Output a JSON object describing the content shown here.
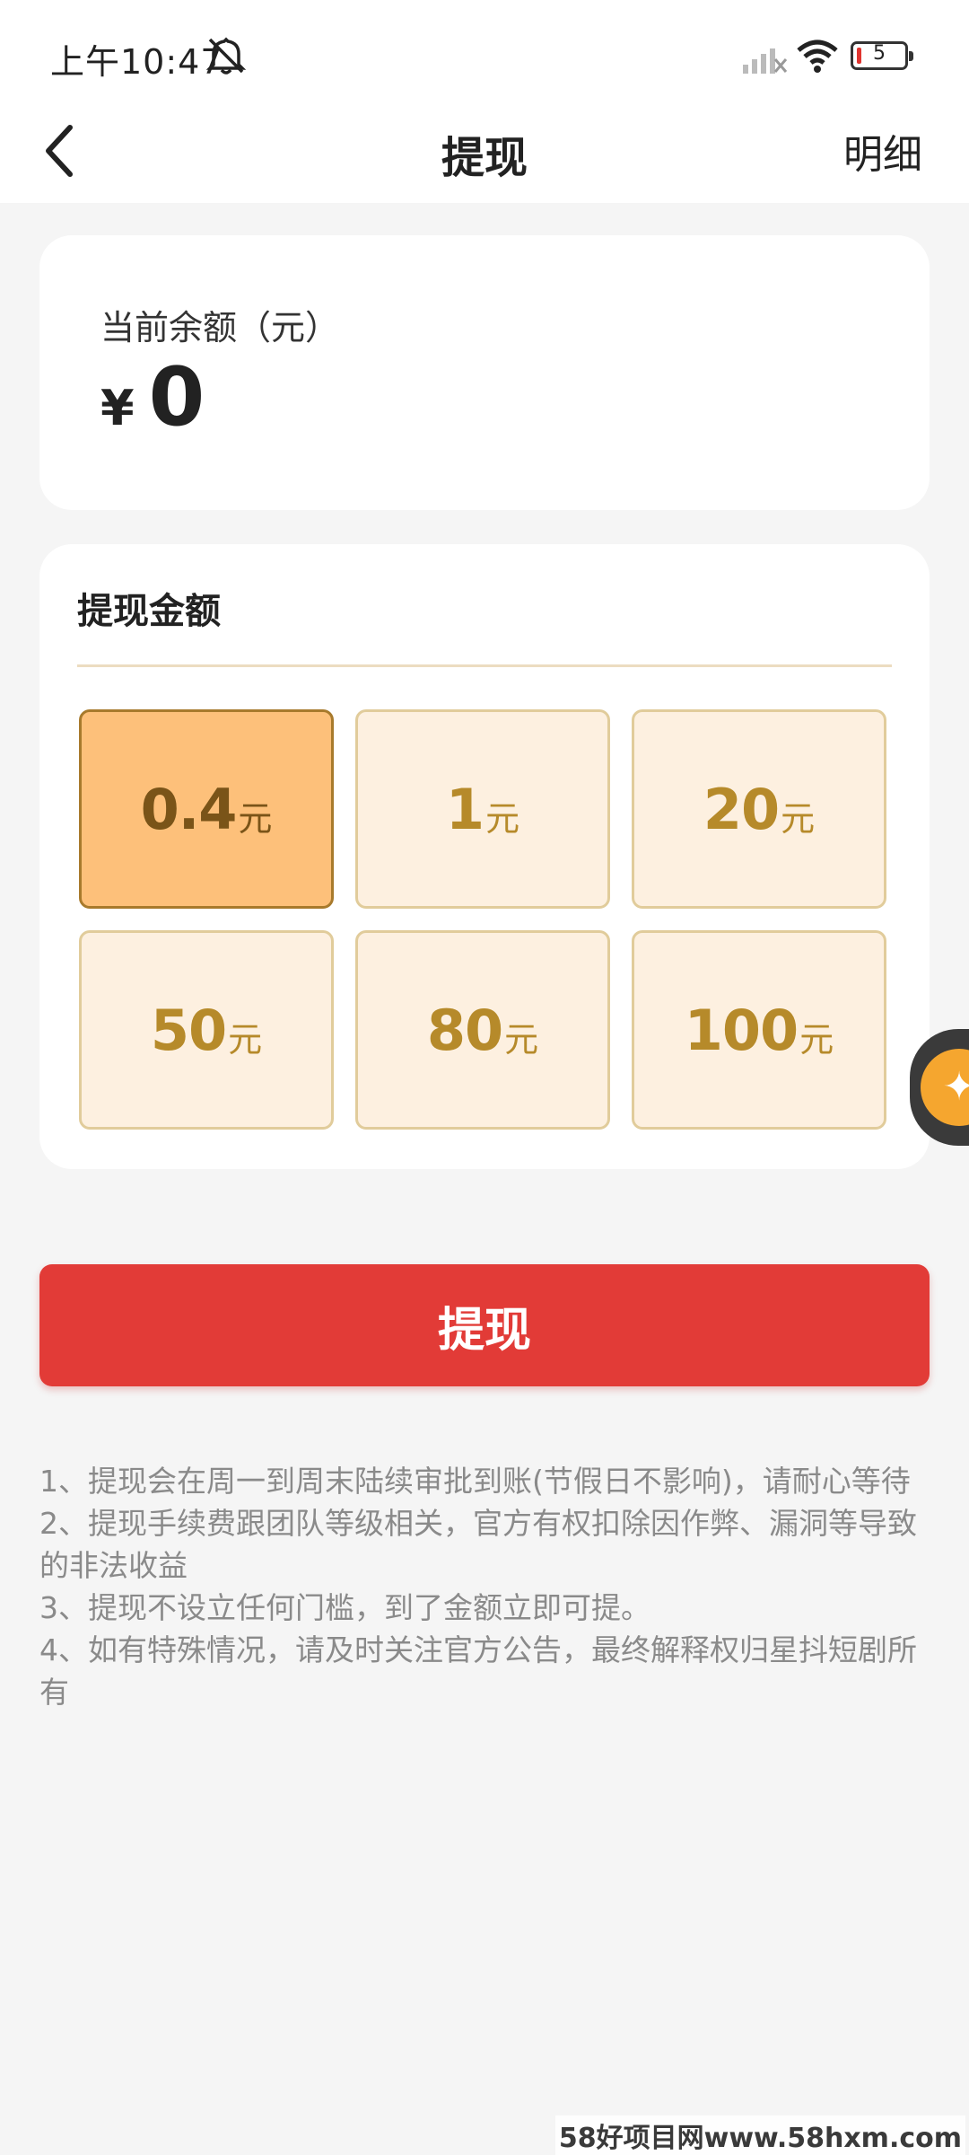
{
  "status_bar": {
    "time": "上午10:47",
    "battery_level": "5",
    "icons": [
      "mute-icon",
      "signal-icon",
      "wifi-icon",
      "battery-icon"
    ]
  },
  "header": {
    "title": "提现",
    "detail_label": "明细",
    "back_icon": "chevron-left-icon"
  },
  "balance": {
    "label": "当前余额（元）",
    "currency": "¥",
    "amount": "0"
  },
  "withdraw": {
    "title": "提现金额",
    "unit": "元",
    "selected_index": 0,
    "options": [
      {
        "amount": "0.4",
        "unit": "元"
      },
      {
        "amount": "1",
        "unit": "元"
      },
      {
        "amount": "20",
        "unit": "元"
      },
      {
        "amount": "50",
        "unit": "元"
      },
      {
        "amount": "80",
        "unit": "元"
      },
      {
        "amount": "100",
        "unit": "元"
      }
    ]
  },
  "submit_label": "提现",
  "notes": [
    "1、提现会在周一到周末陆续审批到账(节假日不影响)，请耐心等待",
    "2、提现手续费跟团队等级相关，官方有权扣除因作弊、漏洞等导致的非法收益",
    " 3、提现不设立任何门槛，到了金额立即可提。",
    " 4、如有特殊情况，请及时关注官方公告，最终解释权归星抖短剧所有"
  ],
  "watermark": "58好项目网www.58hxm.com",
  "colors": {
    "accent_red": "#e23b37",
    "option_bg": "#fdf0e0",
    "option_selected_bg": "#fdc07a",
    "option_text": "#b68a2a"
  }
}
